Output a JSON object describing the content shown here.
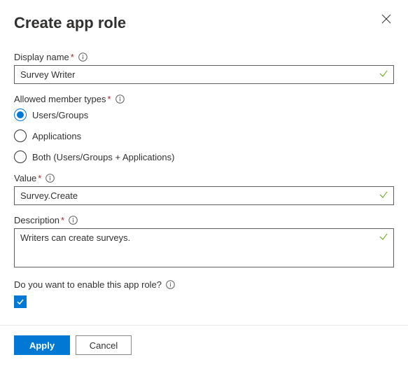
{
  "title": "Create app role",
  "fields": {
    "displayName": {
      "label": "Display name",
      "value": "Survey Writer"
    },
    "allowedTypes": {
      "label": "Allowed member types",
      "options": [
        "Users/Groups",
        "Applications",
        "Both (Users/Groups + Applications)"
      ],
      "selected": 0
    },
    "value": {
      "label": "Value",
      "value": "Survey.Create"
    },
    "description": {
      "label": "Description",
      "value": "Writers can create surveys."
    },
    "enable": {
      "label": "Do you want to enable this app role?",
      "checked": true
    }
  },
  "buttons": {
    "apply": "Apply",
    "cancel": "Cancel"
  }
}
